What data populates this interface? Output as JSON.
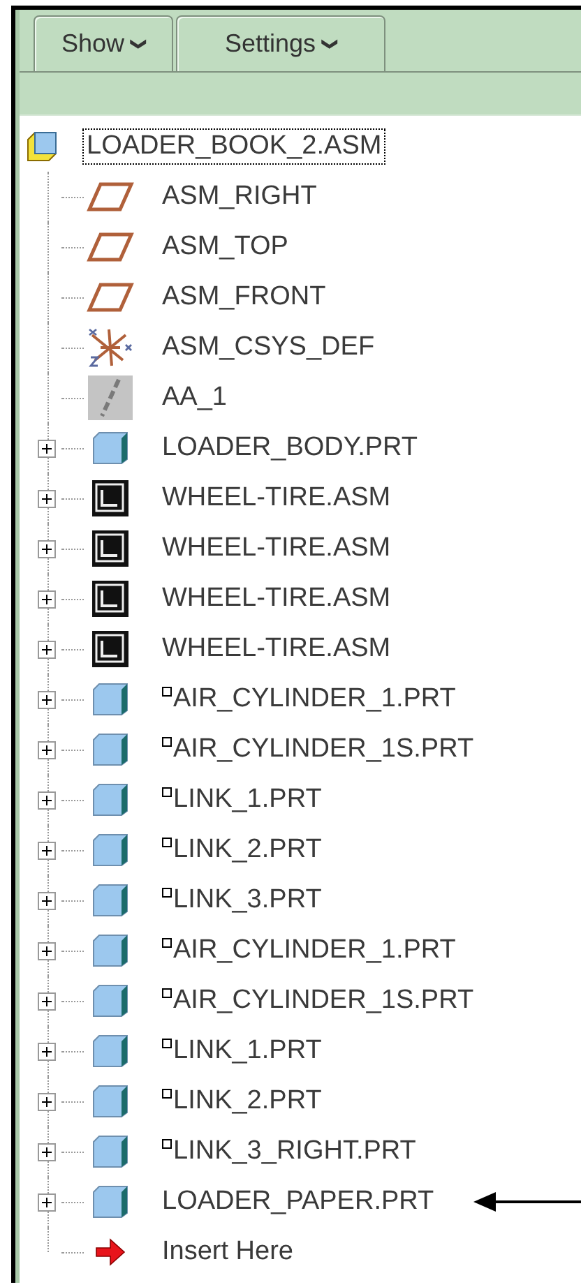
{
  "toolbar": {
    "buttons": [
      {
        "label": "Show",
        "caret": "❯"
      },
      {
        "label": "Settings",
        "caret": "❯"
      }
    ]
  },
  "tree": {
    "root": {
      "label": "LOADER_BOOK_2.ASM",
      "kind": "assembly",
      "selected": true
    },
    "children": [
      {
        "label": "ASM_RIGHT",
        "kind": "plane",
        "expandable": false,
        "marked": false,
        "callout": false
      },
      {
        "label": "ASM_TOP",
        "kind": "plane",
        "expandable": false,
        "marked": false,
        "callout": false
      },
      {
        "label": "ASM_FRONT",
        "kind": "plane",
        "expandable": false,
        "marked": false,
        "callout": false
      },
      {
        "label": "ASM_CSYS_DEF",
        "kind": "csys",
        "expandable": false,
        "marked": false,
        "callout": false
      },
      {
        "label": "AA_1",
        "kind": "axis",
        "expandable": false,
        "marked": false,
        "callout": false
      },
      {
        "label": "LOADER_BODY.PRT",
        "kind": "part",
        "expandable": true,
        "marked": false,
        "callout": false
      },
      {
        "label": "WHEEL-TIRE.ASM",
        "kind": "subassembly",
        "expandable": true,
        "marked": false,
        "callout": false
      },
      {
        "label": "WHEEL-TIRE.ASM",
        "kind": "subassembly",
        "expandable": true,
        "marked": false,
        "callout": false
      },
      {
        "label": "WHEEL-TIRE.ASM",
        "kind": "subassembly",
        "expandable": true,
        "marked": false,
        "callout": false
      },
      {
        "label": "WHEEL-TIRE.ASM",
        "kind": "subassembly",
        "expandable": true,
        "marked": false,
        "callout": false
      },
      {
        "label": "AIR_CYLINDER_1.PRT",
        "kind": "part",
        "expandable": true,
        "marked": true,
        "callout": false
      },
      {
        "label": "AIR_CYLINDER_1S.PRT",
        "kind": "part",
        "expandable": true,
        "marked": true,
        "callout": false
      },
      {
        "label": "LINK_1.PRT",
        "kind": "part",
        "expandable": true,
        "marked": true,
        "callout": false
      },
      {
        "label": "LINK_2.PRT",
        "kind": "part",
        "expandable": true,
        "marked": true,
        "callout": false
      },
      {
        "label": "LINK_3.PRT",
        "kind": "part",
        "expandable": true,
        "marked": true,
        "callout": false
      },
      {
        "label": "AIR_CYLINDER_1.PRT",
        "kind": "part",
        "expandable": true,
        "marked": true,
        "callout": false
      },
      {
        "label": "AIR_CYLINDER_1S.PRT",
        "kind": "part",
        "expandable": true,
        "marked": true,
        "callout": false
      },
      {
        "label": "LINK_1.PRT",
        "kind": "part",
        "expandable": true,
        "marked": true,
        "callout": false
      },
      {
        "label": "LINK_2.PRT",
        "kind": "part",
        "expandable": true,
        "marked": true,
        "callout": false
      },
      {
        "label": "LINK_3_RIGHT.PRT",
        "kind": "part",
        "expandable": true,
        "marked": true,
        "callout": false
      },
      {
        "label": "LOADER_PAPER.PRT",
        "kind": "part",
        "expandable": true,
        "marked": false,
        "callout": true
      },
      {
        "label": "Insert Here",
        "kind": "insert",
        "expandable": false,
        "marked": false,
        "callout": false
      }
    ]
  }
}
